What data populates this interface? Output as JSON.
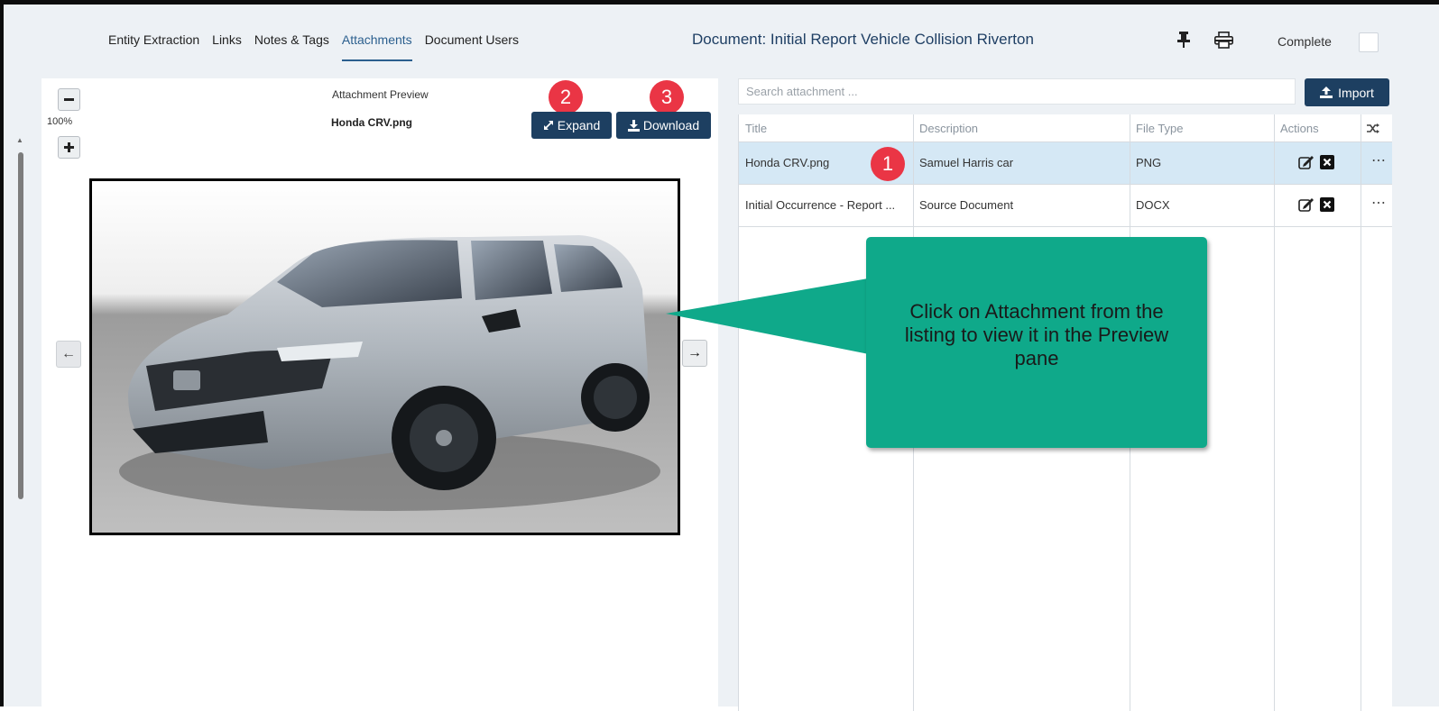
{
  "tabs": [
    {
      "label": "Entity Extraction",
      "active": false
    },
    {
      "label": "Links",
      "active": false
    },
    {
      "label": "Notes & Tags",
      "active": false
    },
    {
      "label": "Attachments",
      "active": true
    },
    {
      "label": "Document Users",
      "active": false
    }
  ],
  "document": {
    "title": "Document: Initial Report Vehicle Collision Riverton"
  },
  "header": {
    "complete_label": "Complete",
    "complete_checked": false
  },
  "preview": {
    "header": "Attachment Preview",
    "filename": "Honda CRV.png",
    "zoom": "100%",
    "expand_label": "Expand",
    "download_label": "Download"
  },
  "search": {
    "placeholder": "Search attachment ..."
  },
  "import_label": "Import",
  "table": {
    "columns": [
      "Title",
      "Description",
      "File Type",
      "Actions"
    ],
    "rows": [
      {
        "title": "Honda CRV.png",
        "description": "Samuel Harris car",
        "file_type": "PNG",
        "selected": true
      },
      {
        "title": "Initial Occurrence - Report ...",
        "description": "Source Document",
        "file_type": "DOCX",
        "selected": false
      }
    ]
  },
  "annotations": {
    "badge_1": "1",
    "badge_2": "2",
    "badge_3": "3",
    "callout_text": "Click on Attachment from the listing to view it in the Preview pane"
  },
  "colors": {
    "accent": "#1d3f61",
    "tab_active": "#2b5f8e",
    "badge": "#ea3545",
    "callout": "#0fa98a",
    "row_selected": "#d5e8f5",
    "background": "#edf1f5"
  }
}
